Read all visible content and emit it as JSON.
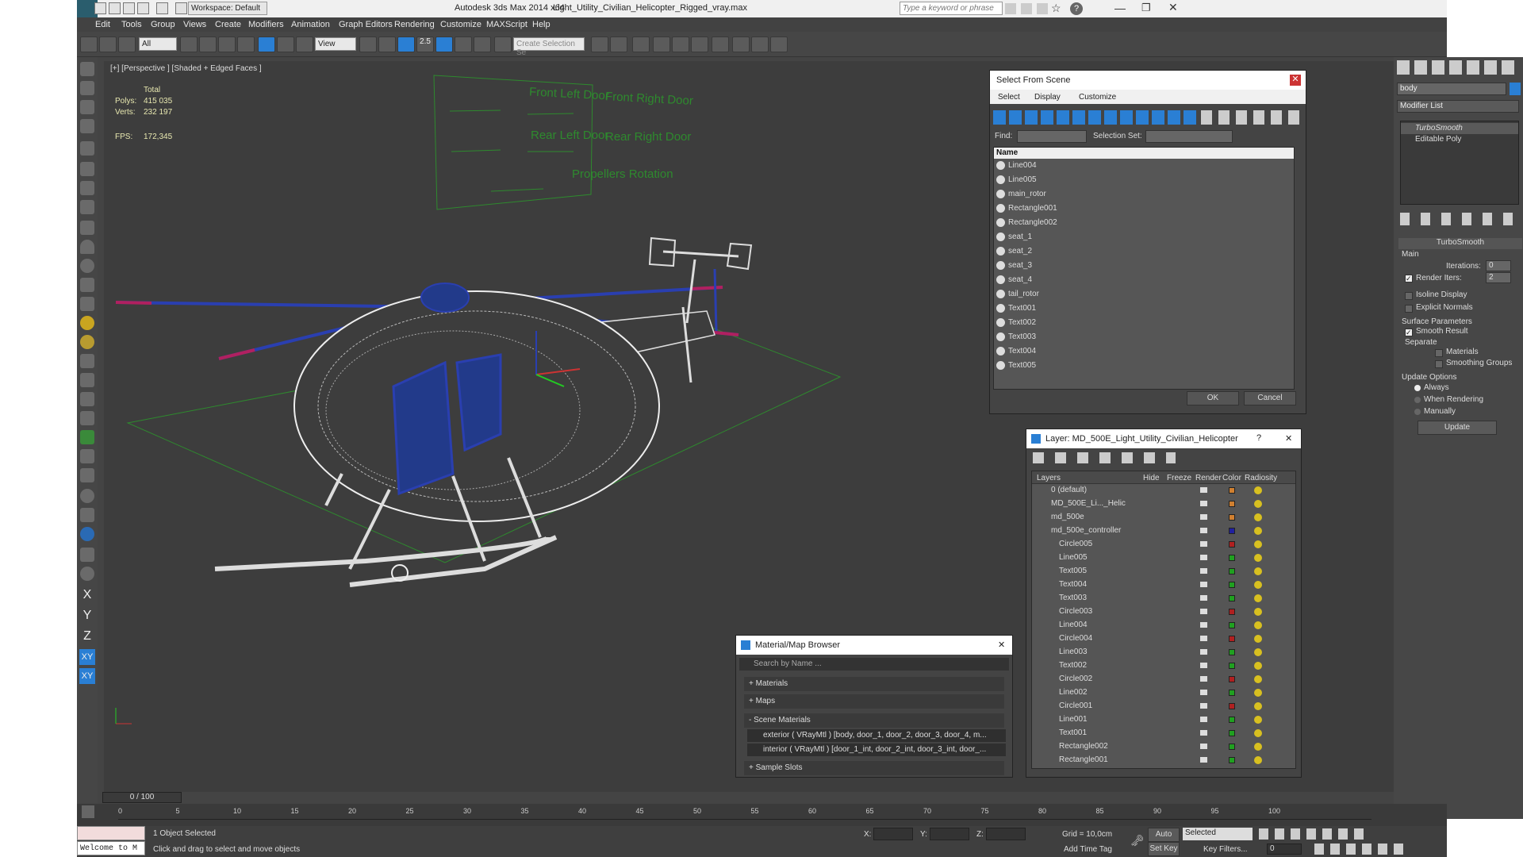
{
  "title_bar": {
    "workspace": "Workspace: Default",
    "app_title": "Autodesk 3ds Max  2014 x64",
    "file_name": "Light_Utility_Civilian_Helicopter_Rigged_vray.max",
    "search_placeholder": "Type a keyword or phrase"
  },
  "menu": [
    "Edit",
    "Tools",
    "Group",
    "Views",
    "Create",
    "Modifiers",
    "Animation",
    "Graph Editors",
    "Rendering",
    "Customize",
    "MAXScript",
    "Help"
  ],
  "toolbar": {
    "filter_value": "All",
    "refcoord_value": "View",
    "snap_label": "2.5",
    "named_selection_placeholder": "Create Selection Se"
  },
  "viewport": {
    "label": "[+] [Perspective ] [Shaded + Edged Faces ]",
    "stats": {
      "header": "Total",
      "polys_label": "Polys:",
      "polys_value": "415 035",
      "verts_label": "Verts:",
      "verts_value": "232 197",
      "fps_label": "FPS:",
      "fps_value": "172,345"
    },
    "control_panel": {
      "front_left": "Front Left Door",
      "front_right": "Front Right Door",
      "rear_left": "Rear Left Door",
      "rear_right": "Rear Right Door",
      "propellers": "Propellers Rotation"
    }
  },
  "select_from_scene": {
    "title": "Select From Scene",
    "menus": [
      "Select",
      "Display",
      "Customize"
    ],
    "find_label": "Find:",
    "selset_label": "Selection Set:",
    "column_name": "Name",
    "items": [
      "Line004",
      "Line005",
      "main_rotor",
      "Rectangle001",
      "Rectangle002",
      "seat_1",
      "seat_2",
      "seat_3",
      "seat_4",
      "tail_rotor",
      "Text001",
      "Text002",
      "Text003",
      "Text004",
      "Text005"
    ],
    "ok": "OK",
    "cancel": "Cancel"
  },
  "layer_manager": {
    "title": "Layer: MD_500E_Light_Utility_Civilian_Helicopter",
    "columns": [
      "Layers",
      "Hide",
      "Freeze",
      "Render",
      "Color",
      "Radiosity"
    ],
    "rows": [
      {
        "name": "0 (default)",
        "color": "#d08030"
      },
      {
        "name": "MD_500E_Li..._Helic",
        "color": "#d08030"
      },
      {
        "name": "md_500e",
        "color": "#d08030"
      },
      {
        "name": "md_500e_controller",
        "color": "#2020a0"
      },
      {
        "name": "Circle005",
        "color": "#b02020"
      },
      {
        "name": "Line005",
        "color": "#20a020"
      },
      {
        "name": "Text005",
        "color": "#20a020"
      },
      {
        "name": "Text004",
        "color": "#20a020"
      },
      {
        "name": "Text003",
        "color": "#20a020"
      },
      {
        "name": "Circle003",
        "color": "#b02020"
      },
      {
        "name": "Line004",
        "color": "#20a020"
      },
      {
        "name": "Circle004",
        "color": "#b02020"
      },
      {
        "name": "Line003",
        "color": "#20a020"
      },
      {
        "name": "Text002",
        "color": "#20a020"
      },
      {
        "name": "Circle002",
        "color": "#b02020"
      },
      {
        "name": "Line002",
        "color": "#20a020"
      },
      {
        "name": "Circle001",
        "color": "#b02020"
      },
      {
        "name": "Line001",
        "color": "#20a020"
      },
      {
        "name": "Text001",
        "color": "#20a020"
      },
      {
        "name": "Rectangle002",
        "color": "#20a020"
      },
      {
        "name": "Rectangle001",
        "color": "#20a020"
      }
    ]
  },
  "material_browser": {
    "title": "Material/Map Browser",
    "search_placeholder": "Search by Name ...",
    "sections": [
      "+ Materials",
      "+ Maps",
      "- Scene Materials"
    ],
    "scene_materials": [
      "exterior  ( VRayMtl )  [body, door_1, door_2, door_3, door_4, m...",
      "interior  ( VRayMtl )  [door_1_int, door_2_int, door_3_int, door_..."
    ],
    "sample_slots": "+ Sample Slots"
  },
  "command_panel": {
    "object_name": "body",
    "modifier_list": "Modifier List",
    "stack": [
      "TurboSmooth",
      "Editable Poly"
    ],
    "rollout_title": "TurboSmooth",
    "main_label": "Main",
    "iterations_label": "Iterations:",
    "iterations_value": "0",
    "render_iters_label": "Render Iters:",
    "render_iters_value": "2",
    "isoline": "Isoline Display",
    "explicit_normals": "Explicit Normals",
    "surface_params": "Surface Parameters",
    "smooth_result": "Smooth Result",
    "separate": "Separate",
    "materials": "Materials",
    "smoothing_groups": "Smoothing Groups",
    "update_options": "Update Options",
    "always": "Always",
    "when_rendering": "When Rendering",
    "manually": "Manually",
    "update_btn": "Update"
  },
  "timeline": {
    "frame_display": "0 / 100",
    "ticks": [
      "0",
      "5",
      "10",
      "15",
      "20",
      "25",
      "30",
      "35",
      "40",
      "45",
      "50",
      "55",
      "60",
      "65",
      "70",
      "75",
      "80",
      "85",
      "90",
      "95",
      "100"
    ]
  },
  "status_bar": {
    "listener": "Welcome to M",
    "selected": "1 Object Selected",
    "prompt": "Click and drag to select and move objects",
    "x_label": "X:",
    "y_label": "Y:",
    "z_label": "Z:",
    "grid": "Grid = 10,0cm",
    "auto_key": "Auto Key",
    "set_key": "Set Key",
    "selected_dropdown": "Selected",
    "key_filters": "Key Filters...",
    "add_time_tag": "Add Time Tag",
    "frame_value": "0"
  }
}
